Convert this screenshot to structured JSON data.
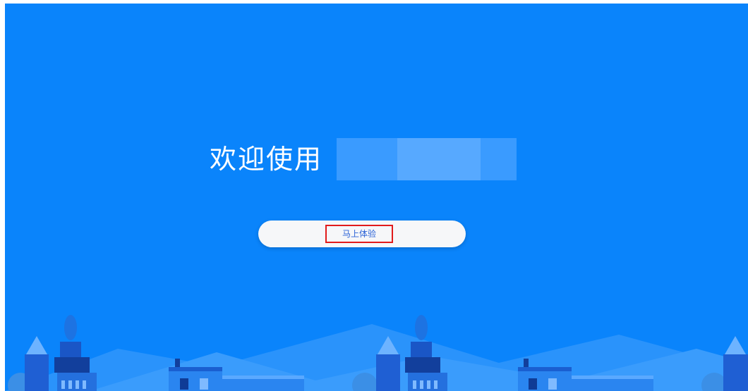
{
  "welcome": {
    "text": "欢迎使用"
  },
  "cta": {
    "label": "马上体验"
  },
  "colors": {
    "background": "#0a84fb",
    "button_bg": "#f6f7f9",
    "button_text": "#2c63d6",
    "highlight_border": "#e11b1b"
  },
  "scenery": {
    "icon": "city-skyline-illustration"
  }
}
